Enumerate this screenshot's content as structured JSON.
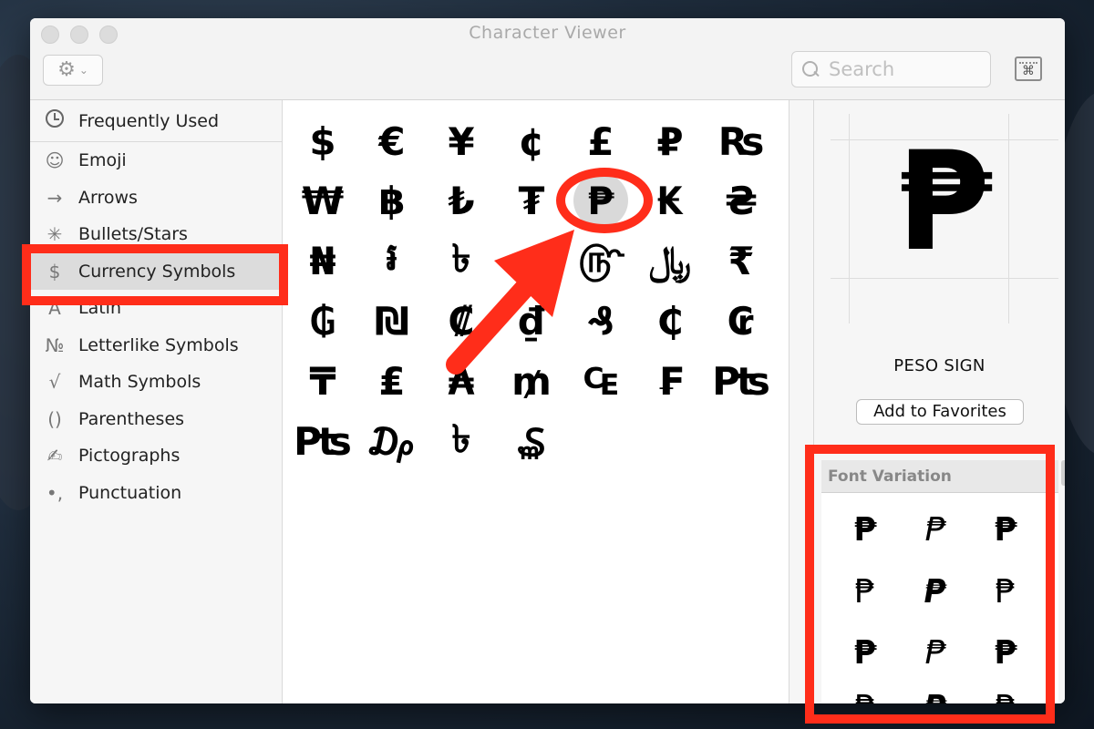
{
  "window": {
    "title": "Character Viewer"
  },
  "toolbar": {
    "search_placeholder": "Search",
    "keyboard_glyph": "⌘"
  },
  "sidebar": {
    "items": [
      {
        "label": "Frequently Used",
        "icon": "clock-icon",
        "glyph": ""
      },
      {
        "label": "Emoji",
        "icon": "smiley-icon",
        "glyph": "☺"
      },
      {
        "label": "Arrows",
        "icon": "arrow-icon",
        "glyph": "→"
      },
      {
        "label": "Bullets/Stars",
        "icon": "asterisk-icon",
        "glyph": "✳"
      },
      {
        "label": "Currency Symbols",
        "icon": "dollar-icon",
        "glyph": "$"
      },
      {
        "label": "Latin",
        "icon": "latin-a-icon",
        "glyph": "A"
      },
      {
        "label": "Letterlike Symbols",
        "icon": "numero-icon",
        "glyph": "№"
      },
      {
        "label": "Math Symbols",
        "icon": "sqrt-icon",
        "glyph": "√"
      },
      {
        "label": "Parentheses",
        "icon": "parentheses-icon",
        "glyph": "()"
      },
      {
        "label": "Pictographs",
        "icon": "pencil-icon",
        "glyph": "✍"
      },
      {
        "label": "Punctuation",
        "icon": "comma-icon",
        "glyph": "•,"
      }
    ],
    "selected": "Currency Symbols"
  },
  "characters": [
    "$",
    "€",
    "¥",
    "¢",
    "£",
    "₽",
    "₨",
    "₩",
    "฿",
    "₺",
    "₮",
    "₱",
    "₭",
    "₴",
    "₦",
    "៛",
    "৳",
    "؋",
    "௹",
    "﷼",
    "₹",
    "₲",
    "₪",
    "₡",
    "₫",
    "₰",
    "₵",
    "₢",
    "₸",
    "₤",
    "₳",
    "₥",
    "₠",
    "₣",
    "₧",
    "₧",
    "₯",
    "৳",
    "₷"
  ],
  "selected_character": "₱",
  "detail": {
    "glyph": "₱",
    "name": "PESO SIGN",
    "add_favorites": "Add to Favorites",
    "font_variation_title": "Font Variation",
    "variations": [
      "₱",
      "₱",
      "₱",
      "₱",
      "₱",
      "₱",
      "₱",
      "₱",
      "₱",
      "₱",
      "₱",
      "₱"
    ]
  },
  "annotation_color": "#ff2d1a"
}
